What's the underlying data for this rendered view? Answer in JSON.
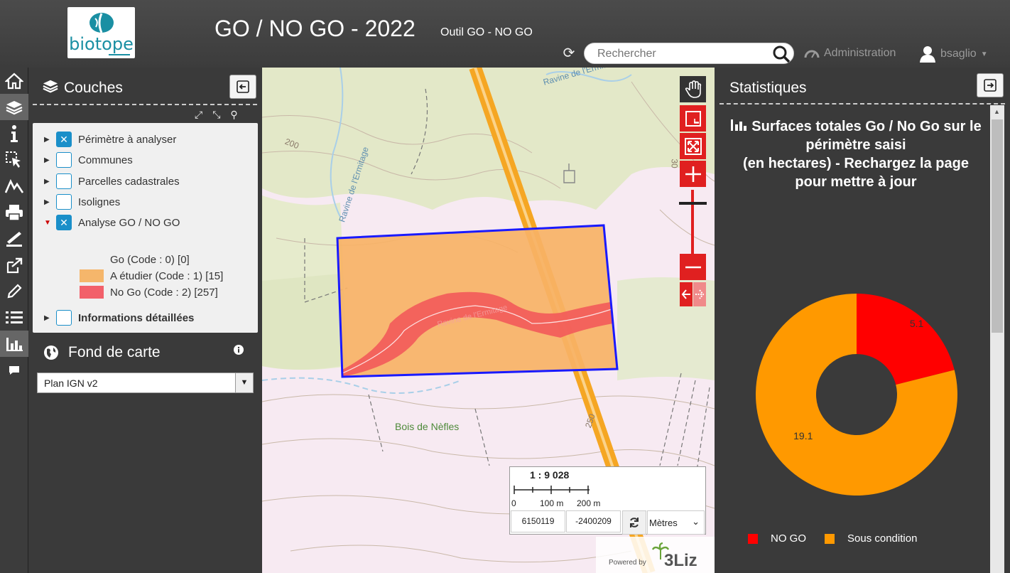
{
  "header": {
    "logo_text": "biotope",
    "title": "GO / NO GO - 2022",
    "subtitle": "Outil GO - NO GO",
    "search_placeholder": "Rechercher",
    "admin_label": "Administration",
    "user_label": "bsaglio"
  },
  "nav_icons": [
    "home-icon",
    "layers-icon",
    "info-icon",
    "selection-icon",
    "elevation-icon",
    "print-icon",
    "measure-icon",
    "export-icon",
    "edit-icon",
    "list-icon",
    "stats-icon",
    "comment-icon"
  ],
  "layers_panel": {
    "title": "Couches",
    "items": [
      {
        "label": "Périmètre à analyser",
        "checked": true,
        "expanded": false
      },
      {
        "label": "Communes",
        "checked": false,
        "expanded": false
      },
      {
        "label": "Parcelles cadastrales",
        "checked": false,
        "expanded": false
      },
      {
        "label": "Isolignes",
        "checked": false,
        "expanded": false
      },
      {
        "label": "Analyse GO / NO GO",
        "checked": true,
        "expanded": true
      },
      {
        "label": "Informations détaillées",
        "checked": false,
        "expanded": false
      }
    ],
    "legend": [
      {
        "label": "Go (Code : 0) [0]",
        "color": ""
      },
      {
        "label": "A étudier (Code : 1) [15]",
        "color": "#f5b66b"
      },
      {
        "label": "No Go (Code : 2) [257]",
        "color": "#f2606a"
      }
    ]
  },
  "basemap": {
    "title": "Fond de carte",
    "selected": "Plan IGN v2"
  },
  "map": {
    "labels": {
      "ravine1": "Ravine de l'Ermitage",
      "ravine2": "Ravine de l'Ermitage",
      "ravine3": "Ravine de l'Ermitage",
      "bois": "Bois de Nèfles",
      "c200": "200",
      "c250": "250",
      "c300": "30"
    },
    "scale": "1 : 9 028",
    "scale_ticks": [
      "0",
      "100 m",
      "200 m"
    ],
    "coord_x": "6150119",
    "coord_y": "-2400209",
    "units": "Mètres",
    "powered_by": "Powered by",
    "brand": "3Liz"
  },
  "stats_panel": {
    "title": "Statistiques"
  },
  "chart_data": {
    "type": "pie",
    "title": "Surfaces totales Go / No Go sur le périmètre saisi (en hectares) - Rechargez la page pour mettre à jour",
    "title_lines": [
      "Surfaces totales Go / No Go sur le",
      "périmètre saisi",
      "(en hectares) - Rechargez la page",
      "pour mettre à jour"
    ],
    "categories": [
      "NO GO",
      "Sous condition"
    ],
    "values": [
      5.1,
      19.1
    ],
    "value_labels": [
      "5.1",
      "19.1"
    ],
    "colors": [
      "#ff0000",
      "#ff9900"
    ],
    "donut": true,
    "legend_position": "bottom"
  }
}
